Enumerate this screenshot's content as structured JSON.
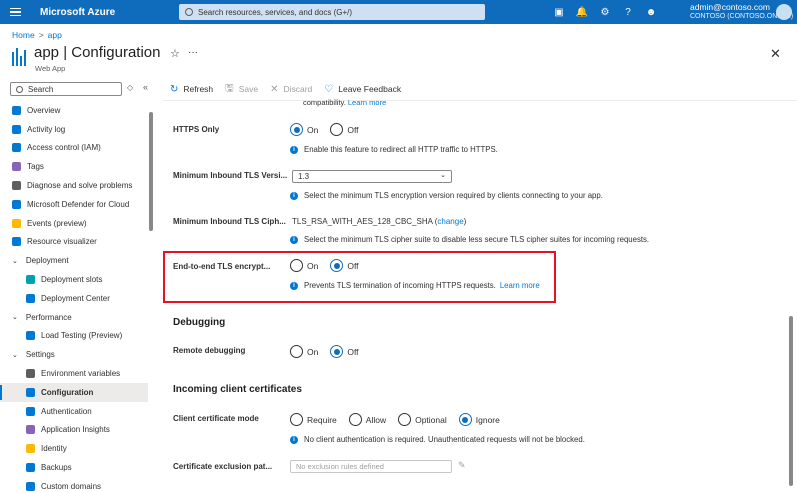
{
  "topbar": {
    "brand": "Microsoft Azure",
    "search_placeholder": "Search resources, services, and docs (G+/)",
    "account_email": "admin@contoso.com",
    "account_tenant": "CONTOSO (CONTOSO.ONMI...)",
    "icons": [
      "cloud-shell-icon",
      "notifications-icon",
      "settings-icon",
      "help-icon",
      "feedback-icon"
    ]
  },
  "breadcrumb": {
    "home": "Home",
    "app": "app"
  },
  "header": {
    "title": "app | Configuration",
    "subtitle": "Web App"
  },
  "sidebar": {
    "search_placeholder": "Search",
    "items": [
      {
        "label": "Overview",
        "level": 0,
        "icon": "globe-icon",
        "color": "#0078d4"
      },
      {
        "label": "Activity log",
        "level": 0,
        "icon": "log-icon",
        "color": "#0078d4"
      },
      {
        "label": "Access control (IAM)",
        "level": 0,
        "icon": "people-icon",
        "color": "#0078d4"
      },
      {
        "label": "Tags",
        "level": 0,
        "icon": "tag-icon",
        "color": "#8764b8"
      },
      {
        "label": "Diagnose and solve problems",
        "level": 0,
        "icon": "wrench-icon",
        "color": "#605e5c"
      },
      {
        "label": "Microsoft Defender for Cloud",
        "level": 0,
        "icon": "shield-icon",
        "color": "#0078d4"
      },
      {
        "label": "Events (preview)",
        "level": 0,
        "icon": "bolt-icon",
        "color": "#ffb900"
      },
      {
        "label": "Resource visualizer",
        "level": 0,
        "icon": "diagram-icon",
        "color": "#0078d4"
      },
      {
        "label": "Deployment",
        "level": 0,
        "group": true
      },
      {
        "label": "Deployment slots",
        "level": 1,
        "icon": "slots-icon",
        "color": "#00a2ad"
      },
      {
        "label": "Deployment Center",
        "level": 1,
        "icon": "cube-icon",
        "color": "#0078d4"
      },
      {
        "label": "Performance",
        "level": 0,
        "group": true
      },
      {
        "label": "Load Testing (Preview)",
        "level": 1,
        "icon": "load-test-icon",
        "color": "#0078d4"
      },
      {
        "label": "Settings",
        "level": 0,
        "group": true
      },
      {
        "label": "Environment variables",
        "level": 1,
        "icon": "env-icon",
        "color": "#605e5c"
      },
      {
        "label": "Configuration",
        "level": 1,
        "icon": "config-icon",
        "color": "#0078d4",
        "active": true
      },
      {
        "label": "Authentication",
        "level": 1,
        "icon": "person-icon",
        "color": "#0078d4"
      },
      {
        "label": "Application Insights",
        "level": 1,
        "icon": "bulb-icon",
        "color": "#8764b8"
      },
      {
        "label": "Identity",
        "level": 1,
        "icon": "key-icon",
        "color": "#ffb900"
      },
      {
        "label": "Backups",
        "level": 1,
        "icon": "backup-icon",
        "color": "#0078d4"
      },
      {
        "label": "Custom domains",
        "level": 1,
        "icon": "domain-icon",
        "color": "#0078d4"
      }
    ]
  },
  "toolbar": {
    "refresh": "Refresh",
    "save": "Save",
    "discard": "Discard",
    "leave_feedback": "Leave Feedback"
  },
  "content": {
    "prev_tail": "compatibility.",
    "prev_tail_link": "Learn more",
    "https_only": {
      "label": "HTTPS Only",
      "on": "On",
      "off": "Off",
      "selected": "On",
      "info": "Enable this feature to redirect all HTTP traffic to HTTPS."
    },
    "min_tls": {
      "label": "Minimum Inbound TLS Versi...",
      "value": "1.3",
      "info": "Select the minimum TLS encryption version required by clients connecting to your app."
    },
    "min_cipher": {
      "label": "Minimum Inbound TLS Ciph...",
      "value": "TLS_RSA_WITH_AES_128_CBC_SHA",
      "change_link": "change",
      "info": "Select the minimum TLS cipher suite to disable less secure TLS cipher suites for incoming requests."
    },
    "e2e_tls": {
      "label": "End-to-end TLS encrypt...",
      "on": "On",
      "off": "Off",
      "selected": "Off",
      "info": "Prevents TLS termination of incoming HTTPS requests.",
      "info_link": "Learn more"
    },
    "debugging": {
      "heading": "Debugging",
      "remote_label": "Remote debugging",
      "on": "On",
      "off": "Off",
      "selected": "Off"
    },
    "client_certs": {
      "heading": "Incoming client certificates",
      "mode_label": "Client certificate mode",
      "options": [
        "Require",
        "Allow",
        "Optional",
        "Ignore"
      ],
      "selected": "Ignore",
      "info": "No client authentication is required. Unauthenticated requests will not be blocked.",
      "exclusion_label": "Certificate exclusion pat...",
      "exclusion_placeholder": "No exclusion rules defined"
    }
  }
}
